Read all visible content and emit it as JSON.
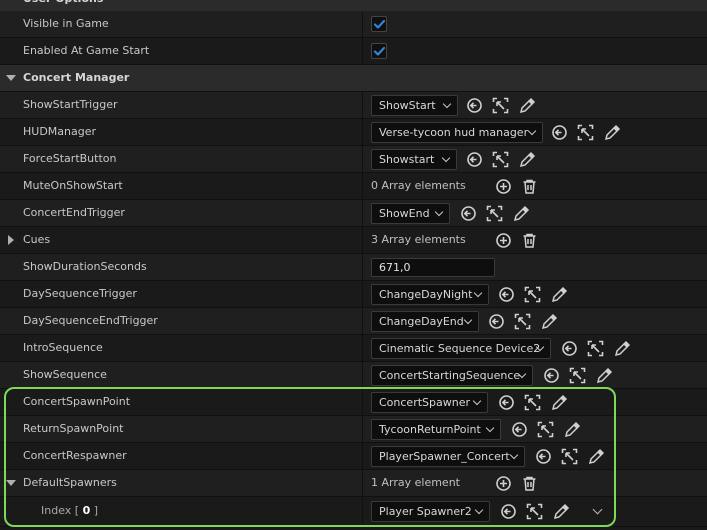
{
  "sections": {
    "user_options": "User Options",
    "concert_manager": "Concert Manager"
  },
  "rows": {
    "visible_in_game": {
      "label": "Visible in Game",
      "checked": true
    },
    "enabled_at_game_start": {
      "label": "Enabled At Game Start",
      "checked": true
    },
    "show_start_trigger": {
      "label": "ShowStartTrigger",
      "value": "ShowStart"
    },
    "hud_manager": {
      "label": "HUDManager",
      "value": "Verse-tycoon hud manager"
    },
    "force_start_button": {
      "label": "ForceStartButton",
      "value": "Showstart"
    },
    "mute_on_show_start": {
      "label": "MuteOnShowStart",
      "value": "0 Array elements"
    },
    "concert_end_trigger": {
      "label": "ConcertEndTrigger",
      "value": "ShowEnd"
    },
    "cues": {
      "label": "Cues",
      "value": "3 Array elements"
    },
    "show_duration_seconds": {
      "label": "ShowDurationSeconds",
      "value": "671,0"
    },
    "day_sequence_trigger": {
      "label": "DaySequenceTrigger",
      "value": "ChangeDayNight"
    },
    "day_sequence_end_trigger": {
      "label": "DaySequenceEndTrigger",
      "value": "ChangeDayEnd"
    },
    "intro_sequence": {
      "label": "IntroSequence",
      "value": "Cinematic Sequence Device2"
    },
    "show_sequence": {
      "label": "ShowSequence",
      "value": "ConcertStartingSequence"
    },
    "concert_spawn_point": {
      "label": "ConcertSpawnPoint",
      "value": "ConcertSpawner"
    },
    "return_spawn_point": {
      "label": "ReturnSpawnPoint",
      "value": "TycoonReturnPoint"
    },
    "concert_respawner": {
      "label": "ConcertRespawner",
      "value": "PlayerSpawner_Concert"
    },
    "default_spawners": {
      "label": "DefaultSpawners",
      "value": "1 Array element"
    },
    "index_0": {
      "label_prefix": "Index [",
      "index": "0",
      "label_suffix": "]",
      "value": "Player Spawner2"
    }
  },
  "colors": {
    "highlight": "#7ed957",
    "checkbox": "#2f86d6"
  },
  "icons": [
    "use-selected-icon",
    "browse-icon",
    "pick-actor-icon",
    "add-element-icon",
    "delete-all-icon",
    "chevron-down-icon"
  ]
}
